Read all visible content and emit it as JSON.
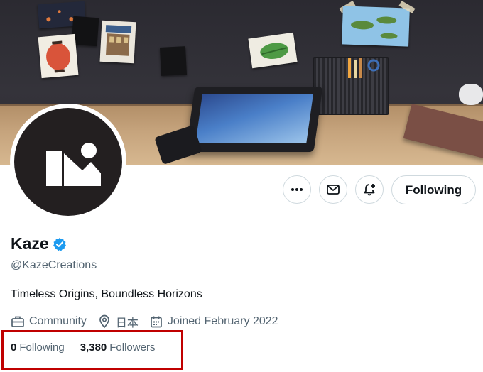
{
  "profile": {
    "name": "Kaze",
    "handle": "@KazeCreations",
    "bio": "Timeless Origins, Boundless Horizons",
    "verified": true,
    "verified_icon": "verified-badge-icon",
    "accent_color": "#1d9bf0"
  },
  "meta": {
    "category": "Community",
    "category_icon": "briefcase-icon",
    "location": "日本",
    "location_icon": "location-pin-icon",
    "joined": "Joined February 2022",
    "joined_icon": "calendar-icon"
  },
  "stats": {
    "following_count": "0",
    "following_label": "Following",
    "followers_count": "3,380",
    "followers_label": "Followers"
  },
  "actions": {
    "more_icon": "more-horizontal-icon",
    "message_icon": "envelope-icon",
    "notify_icon": "bell-plus-icon",
    "follow_label": "Following"
  },
  "highlight_color": "#c00000"
}
